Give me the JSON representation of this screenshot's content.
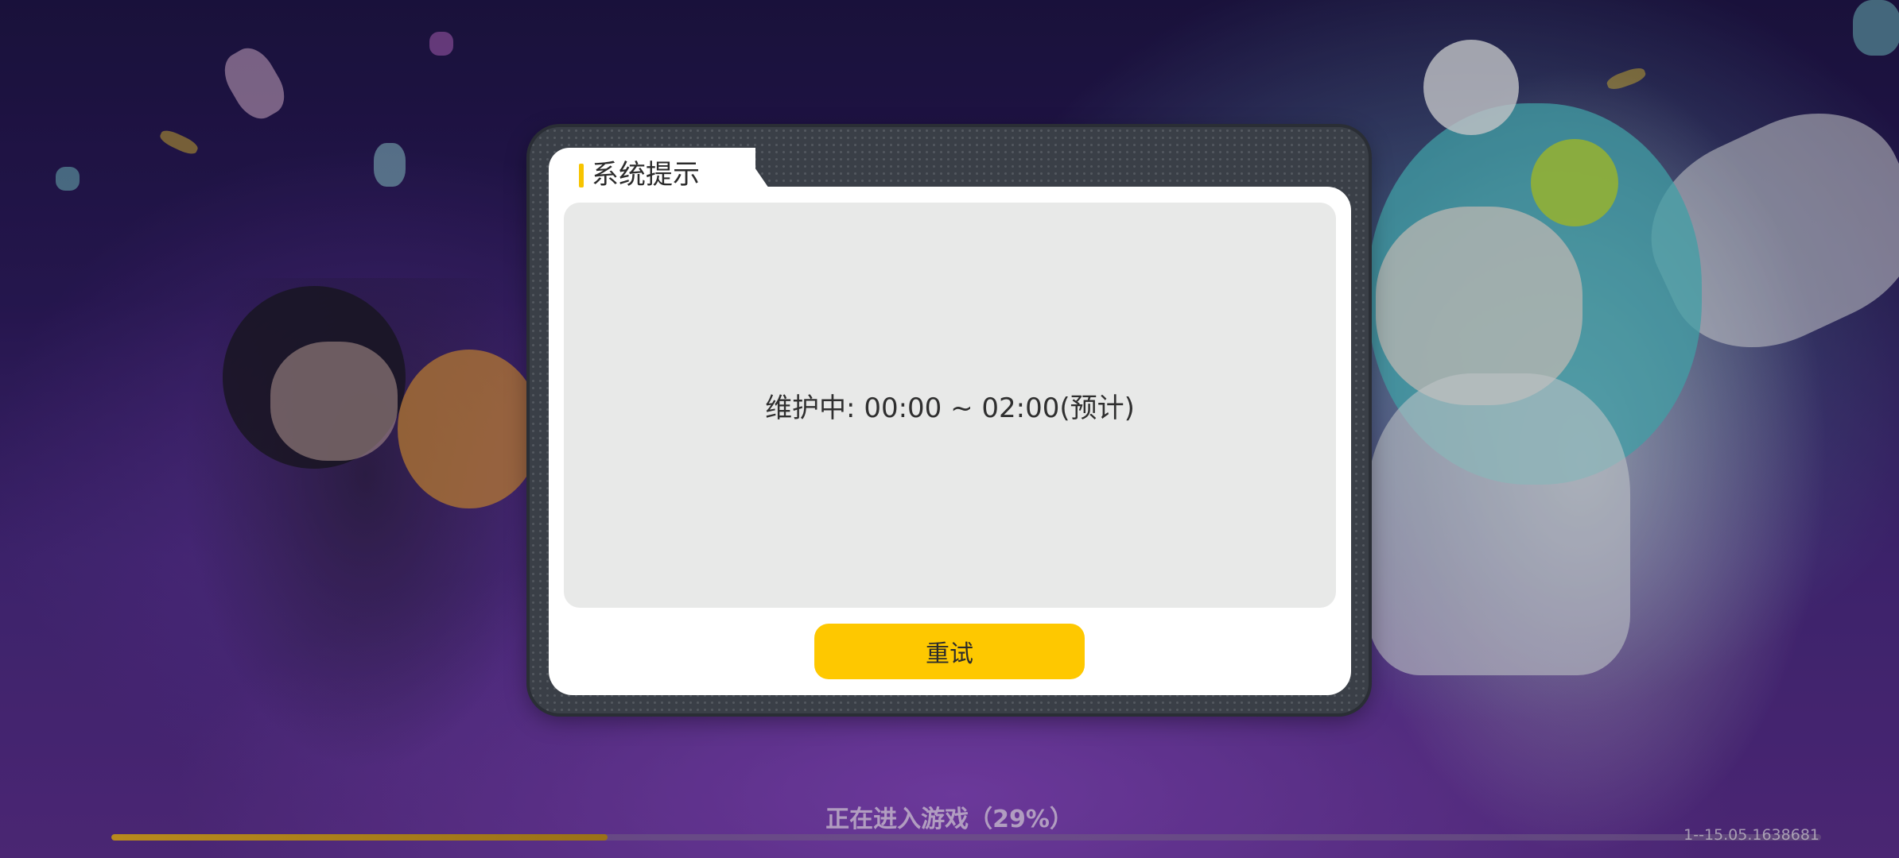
{
  "dialog": {
    "title": "系统提示",
    "message": "维护中: 00:00 ~ 02:00(预计)",
    "retry_label": "重试"
  },
  "loading": {
    "text": "正在进入游戏（29%）",
    "progress": 0.29
  },
  "version": "1--15.05.1638681",
  "colors": {
    "accent_yellow": "#fec800",
    "title_bar": "#f7c400",
    "content_bg": "#e8e9e8",
    "frame": "#3a3f47"
  }
}
